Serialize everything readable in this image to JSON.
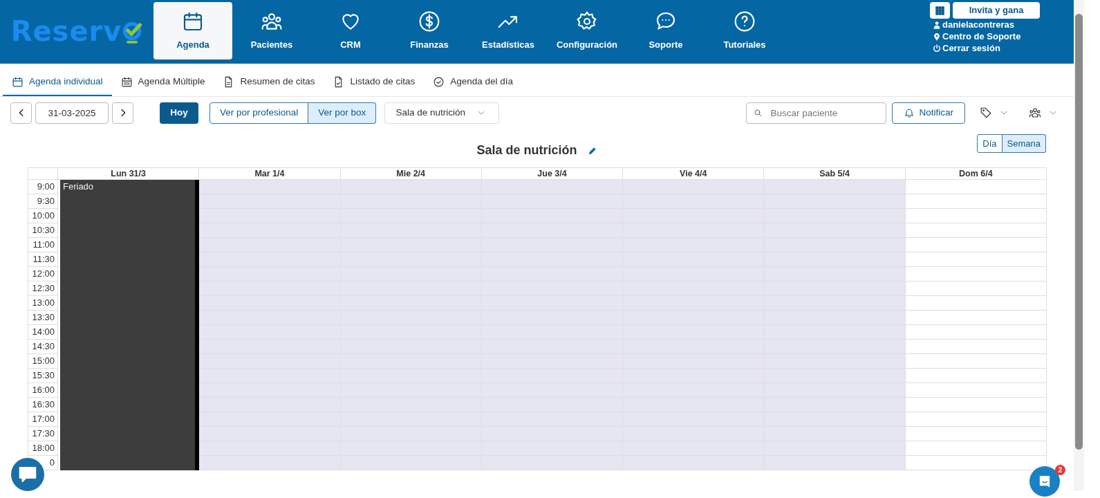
{
  "header": {
    "logo": "Reserv",
    "nav": [
      {
        "label": "Agenda",
        "selected": true
      },
      {
        "label": "Pacientes",
        "selected": false
      },
      {
        "label": "CRM",
        "selected": false
      },
      {
        "label": "Finanzas",
        "selected": false
      },
      {
        "label": "Estadísticas",
        "selected": false
      },
      {
        "label": "Configuración",
        "selected": false
      },
      {
        "label": "Soporte",
        "selected": false
      },
      {
        "label": "Tutoriales",
        "selected": false
      }
    ],
    "invite_button": "Invita y gana",
    "user_links": [
      {
        "label": "danielacontreras"
      },
      {
        "label": "Centro de Soporte"
      },
      {
        "label": "Cerrar sesión"
      }
    ]
  },
  "subtabs": [
    {
      "label": "Agenda individual",
      "selected": true
    },
    {
      "label": "Agenda Múltiple",
      "selected": false
    },
    {
      "label": "Resumen de citas",
      "selected": false
    },
    {
      "label": "Listado de citas",
      "selected": false
    },
    {
      "label": "Agenda del día",
      "selected": false
    }
  ],
  "toolbar": {
    "date": "31-03-2025",
    "today_button": "Hoy",
    "view_toggle": [
      {
        "label": "Ver por profesional",
        "selected": false
      },
      {
        "label": "Ver por box",
        "selected": true
      }
    ],
    "room_select": "Sala de nutrición",
    "search": {
      "placeholder": "Buscar paciente"
    },
    "notify_button": "Notificar"
  },
  "calendar": {
    "title": "Sala de nutrición",
    "range_toggle": [
      {
        "label": "Día",
        "selected": false
      },
      {
        "label": "Semana",
        "selected": true
      }
    ],
    "days": [
      {
        "label": "Lun 31/3",
        "kind": "holiday",
        "event": "Feriado"
      },
      {
        "label": "Mar 1/4",
        "kind": "shaded"
      },
      {
        "label": "Mie 2/4",
        "kind": "shaded"
      },
      {
        "label": "Jue 3/4",
        "kind": "shaded"
      },
      {
        "label": "Vie 4/4",
        "kind": "shaded"
      },
      {
        "label": "Sab 5/4",
        "kind": "shaded"
      },
      {
        "label": "Dom 6/4",
        "kind": "plain"
      }
    ],
    "times": [
      "9:00",
      "9:30",
      "10:00",
      "10:30",
      "11:00",
      "11:30",
      "12:00",
      "12:30",
      "13:00",
      "13:30",
      "14:00",
      "14:30",
      "15:00",
      "15:30",
      "16:00",
      "16:30",
      "17:00",
      "17:30",
      "18:00",
      "0"
    ]
  },
  "messenger_badge": "2"
}
